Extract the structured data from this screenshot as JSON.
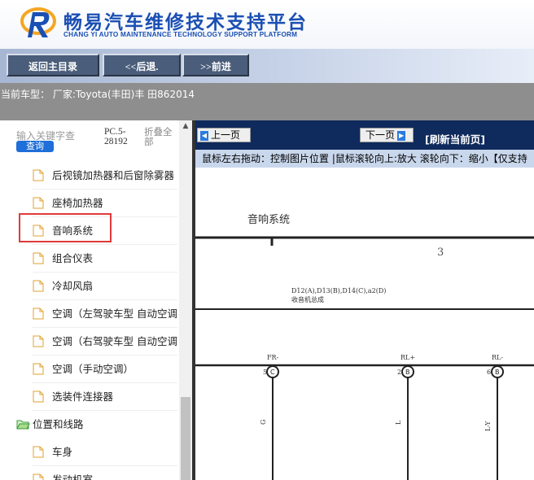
{
  "header": {
    "title": "畅易汽车维修技术支持平台",
    "subtitle": "CHANG YI AUTO MAINTENANCE TECHNOLOGY SUPPORT PLATFORM",
    "brand_color": "#1a4fb3"
  },
  "toolbar": {
    "main_menu_label": "返回主目录",
    "back_label": "<<后退.",
    "forward_label": ">>前进"
  },
  "vehicle": {
    "text": "当前车型： 厂家:Toyota(丰田)丰 田862014"
  },
  "sidebar": {
    "search_placeholder": "输入关键字查",
    "search_button": "查询",
    "pc_version": "PC.5-28192",
    "collapse_all": "折叠全部",
    "items": [
      {
        "label": "后视镜加热器和后窗除雾器",
        "icon": "file-icon"
      },
      {
        "label": "座椅加热器",
        "icon": "file-icon"
      },
      {
        "label": "音响系统",
        "icon": "file-icon",
        "highlighted": true
      },
      {
        "label": "组合仪表",
        "icon": "file-icon"
      },
      {
        "label": "冷却风扇",
        "icon": "file-icon"
      },
      {
        "label": "空调（左驾驶车型 自动空调",
        "icon": "file-icon"
      },
      {
        "label": "空调（右驾驶车型 自动空调",
        "icon": "file-icon"
      },
      {
        "label": "空调（手动空调）",
        "icon": "file-icon"
      },
      {
        "label": "选装件连接器",
        "icon": "file-icon"
      },
      {
        "label": "位置和线路",
        "icon": "folder-open-icon"
      },
      {
        "label": "车身",
        "icon": "file-icon"
      },
      {
        "label": "发动机室",
        "icon": "file-icon"
      }
    ]
  },
  "pager": {
    "prev_label": "上一页",
    "next_label": "下一页",
    "refresh_label": "[刷新当前页]",
    "hint": "鼠标左右拖动：控制图片位置 |鼠标滚轮向上:放大  滚轮向下：缩小【仅支持"
  },
  "diagram": {
    "title": "音响系统",
    "page_number": "3",
    "component_label_1": "D12(A),D13(B),D14(C),a2(D)",
    "component_label_2": "收音机总成",
    "pins": [
      {
        "name": "FR-",
        "connector": "C",
        "pin": "5",
        "wire": "G"
      },
      {
        "name": "RL+",
        "connector": "B",
        "pin": "2",
        "wire": "L"
      },
      {
        "name": "RL-",
        "connector": "B",
        "pin": "6",
        "wire": "L-Y"
      }
    ]
  }
}
